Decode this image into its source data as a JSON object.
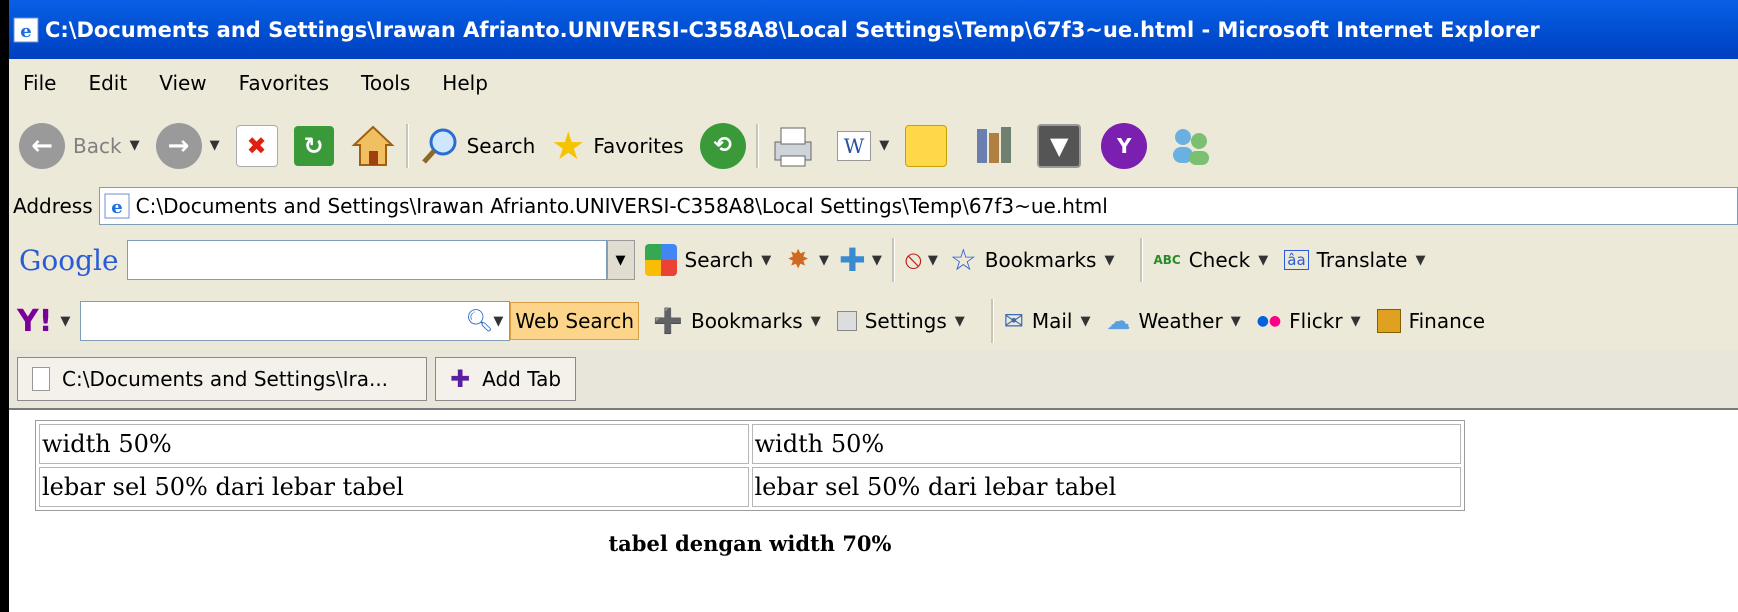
{
  "window": {
    "title": "C:\\Documents and Settings\\Irawan Afrianto.UNIVERSI-C358A8\\Local Settings\\Temp\\67f3~ue.html - Microsoft Internet Explorer"
  },
  "menu": [
    "File",
    "Edit",
    "View",
    "Favorites",
    "Tools",
    "Help"
  ],
  "toolbar": {
    "back_label": "Back",
    "search_label": "Search",
    "favorites_label": "Favorites"
  },
  "address": {
    "label": "Address",
    "value": "C:\\Documents and Settings\\Irawan Afrianto.UNIVERSI-C358A8\\Local Settings\\Temp\\67f3~ue.html"
  },
  "google": {
    "logo": "Google",
    "search_label": "Search",
    "bookmarks_label": "Bookmarks",
    "check_label": "Check",
    "check_icon_text": "ABC",
    "translate_label": "Translate",
    "translate_icon_text": "âa"
  },
  "yahoo": {
    "logo": "Y!",
    "websearch_label": "Web Search",
    "bookmarks_label": "Bookmarks",
    "settings_label": "Settings",
    "mail_label": "Mail",
    "weather_label": "Weather",
    "flickr_label": "Flickr",
    "finance_label": "Finance"
  },
  "tabs": {
    "active_label": "C:\\Documents and Settings\\Ira...",
    "add_label": "Add Tab"
  },
  "page": {
    "rows": [
      [
        "width 50%",
        "width 50%"
      ],
      [
        "lebar sel 50% dari lebar tabel",
        "lebar sel 50% dari lebar tabel"
      ]
    ],
    "caption": "tabel dengan width 70%"
  },
  "colors": {
    "titlebar": "#0A5FE6",
    "chrome": "#ECE9D8"
  }
}
